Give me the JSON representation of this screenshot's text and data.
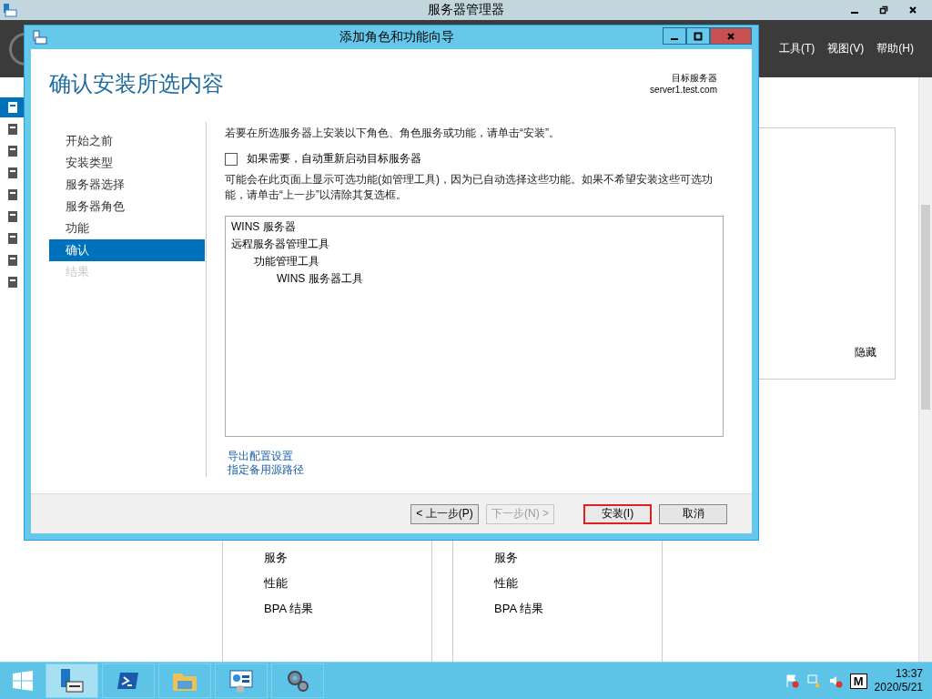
{
  "app": {
    "title": "服务器管理器",
    "menu": [
      "工具(T)",
      "视图(V)",
      "帮助(H)"
    ],
    "sidebar": [
      {
        "selected": true
      },
      {
        "selected": false
      },
      {
        "selected": false
      },
      {
        "selected": false
      },
      {
        "selected": false
      },
      {
        "selected": false
      },
      {
        "selected": false
      },
      {
        "selected": false
      },
      {
        "selected": false
      }
    ],
    "panel": {
      "link": "隐藏"
    },
    "tiles": [
      {
        "items": [
          "服务",
          "性能",
          "BPA 结果"
        ]
      },
      {
        "items": [
          "服务",
          "性能",
          "BPA 结果"
        ]
      }
    ]
  },
  "dialog": {
    "title": "添加角色和功能向导",
    "heading": "确认安装所选内容",
    "target_label": "目标服务器",
    "target_server": "server1.test.com",
    "steps": [
      {
        "label": "开始之前",
        "selected": false,
        "disabled": false
      },
      {
        "label": "安装类型",
        "selected": false,
        "disabled": false
      },
      {
        "label": "服务器选择",
        "selected": false,
        "disabled": false
      },
      {
        "label": "服务器角色",
        "selected": false,
        "disabled": false
      },
      {
        "label": "功能",
        "selected": false,
        "disabled": false
      },
      {
        "label": "确认",
        "selected": true,
        "disabled": false
      },
      {
        "label": "结果",
        "selected": false,
        "disabled": true
      }
    ],
    "instruction": "若要在所选服务器上安装以下角色、角色服务或功能，请单击“安装”。",
    "restart": {
      "label": "如果需要，自动重新启动目标服务器",
      "checked": false
    },
    "note": "可能会在此页面上显示可选功能(如管理工具)，因为已自动选择这些功能。如果不希望安装这些可选功能，请单击“上一步”以清除其复选框。",
    "selection": [
      {
        "label": "WINS 服务器"
      },
      {
        "label": "远程服务器管理工具",
        "children": [
          {
            "label": "功能管理工具",
            "children": [
              {
                "label": "WINS 服务器工具"
              }
            ]
          }
        ]
      }
    ],
    "links": [
      "导出配置设置",
      "指定备用源路径"
    ],
    "buttons": [
      {
        "label": "< 上一步(P)",
        "disabled": false,
        "highlighted": false
      },
      {
        "label": "下一步(N) >",
        "disabled": true,
        "highlighted": false
      },
      {
        "label": "安装(I)",
        "disabled": false,
        "highlighted": true
      },
      {
        "label": "取消",
        "disabled": false,
        "highlighted": false
      }
    ]
  },
  "taskbar": {
    "apps": [
      {
        "kind": "server",
        "active": true
      },
      {
        "kind": "shell",
        "active": false
      },
      {
        "kind": "folder",
        "active": false
      },
      {
        "kind": "panel",
        "active": false
      },
      {
        "kind": "gears",
        "active": false
      }
    ],
    "ime": "M",
    "time": "13:37",
    "date": "2020/5/21"
  }
}
